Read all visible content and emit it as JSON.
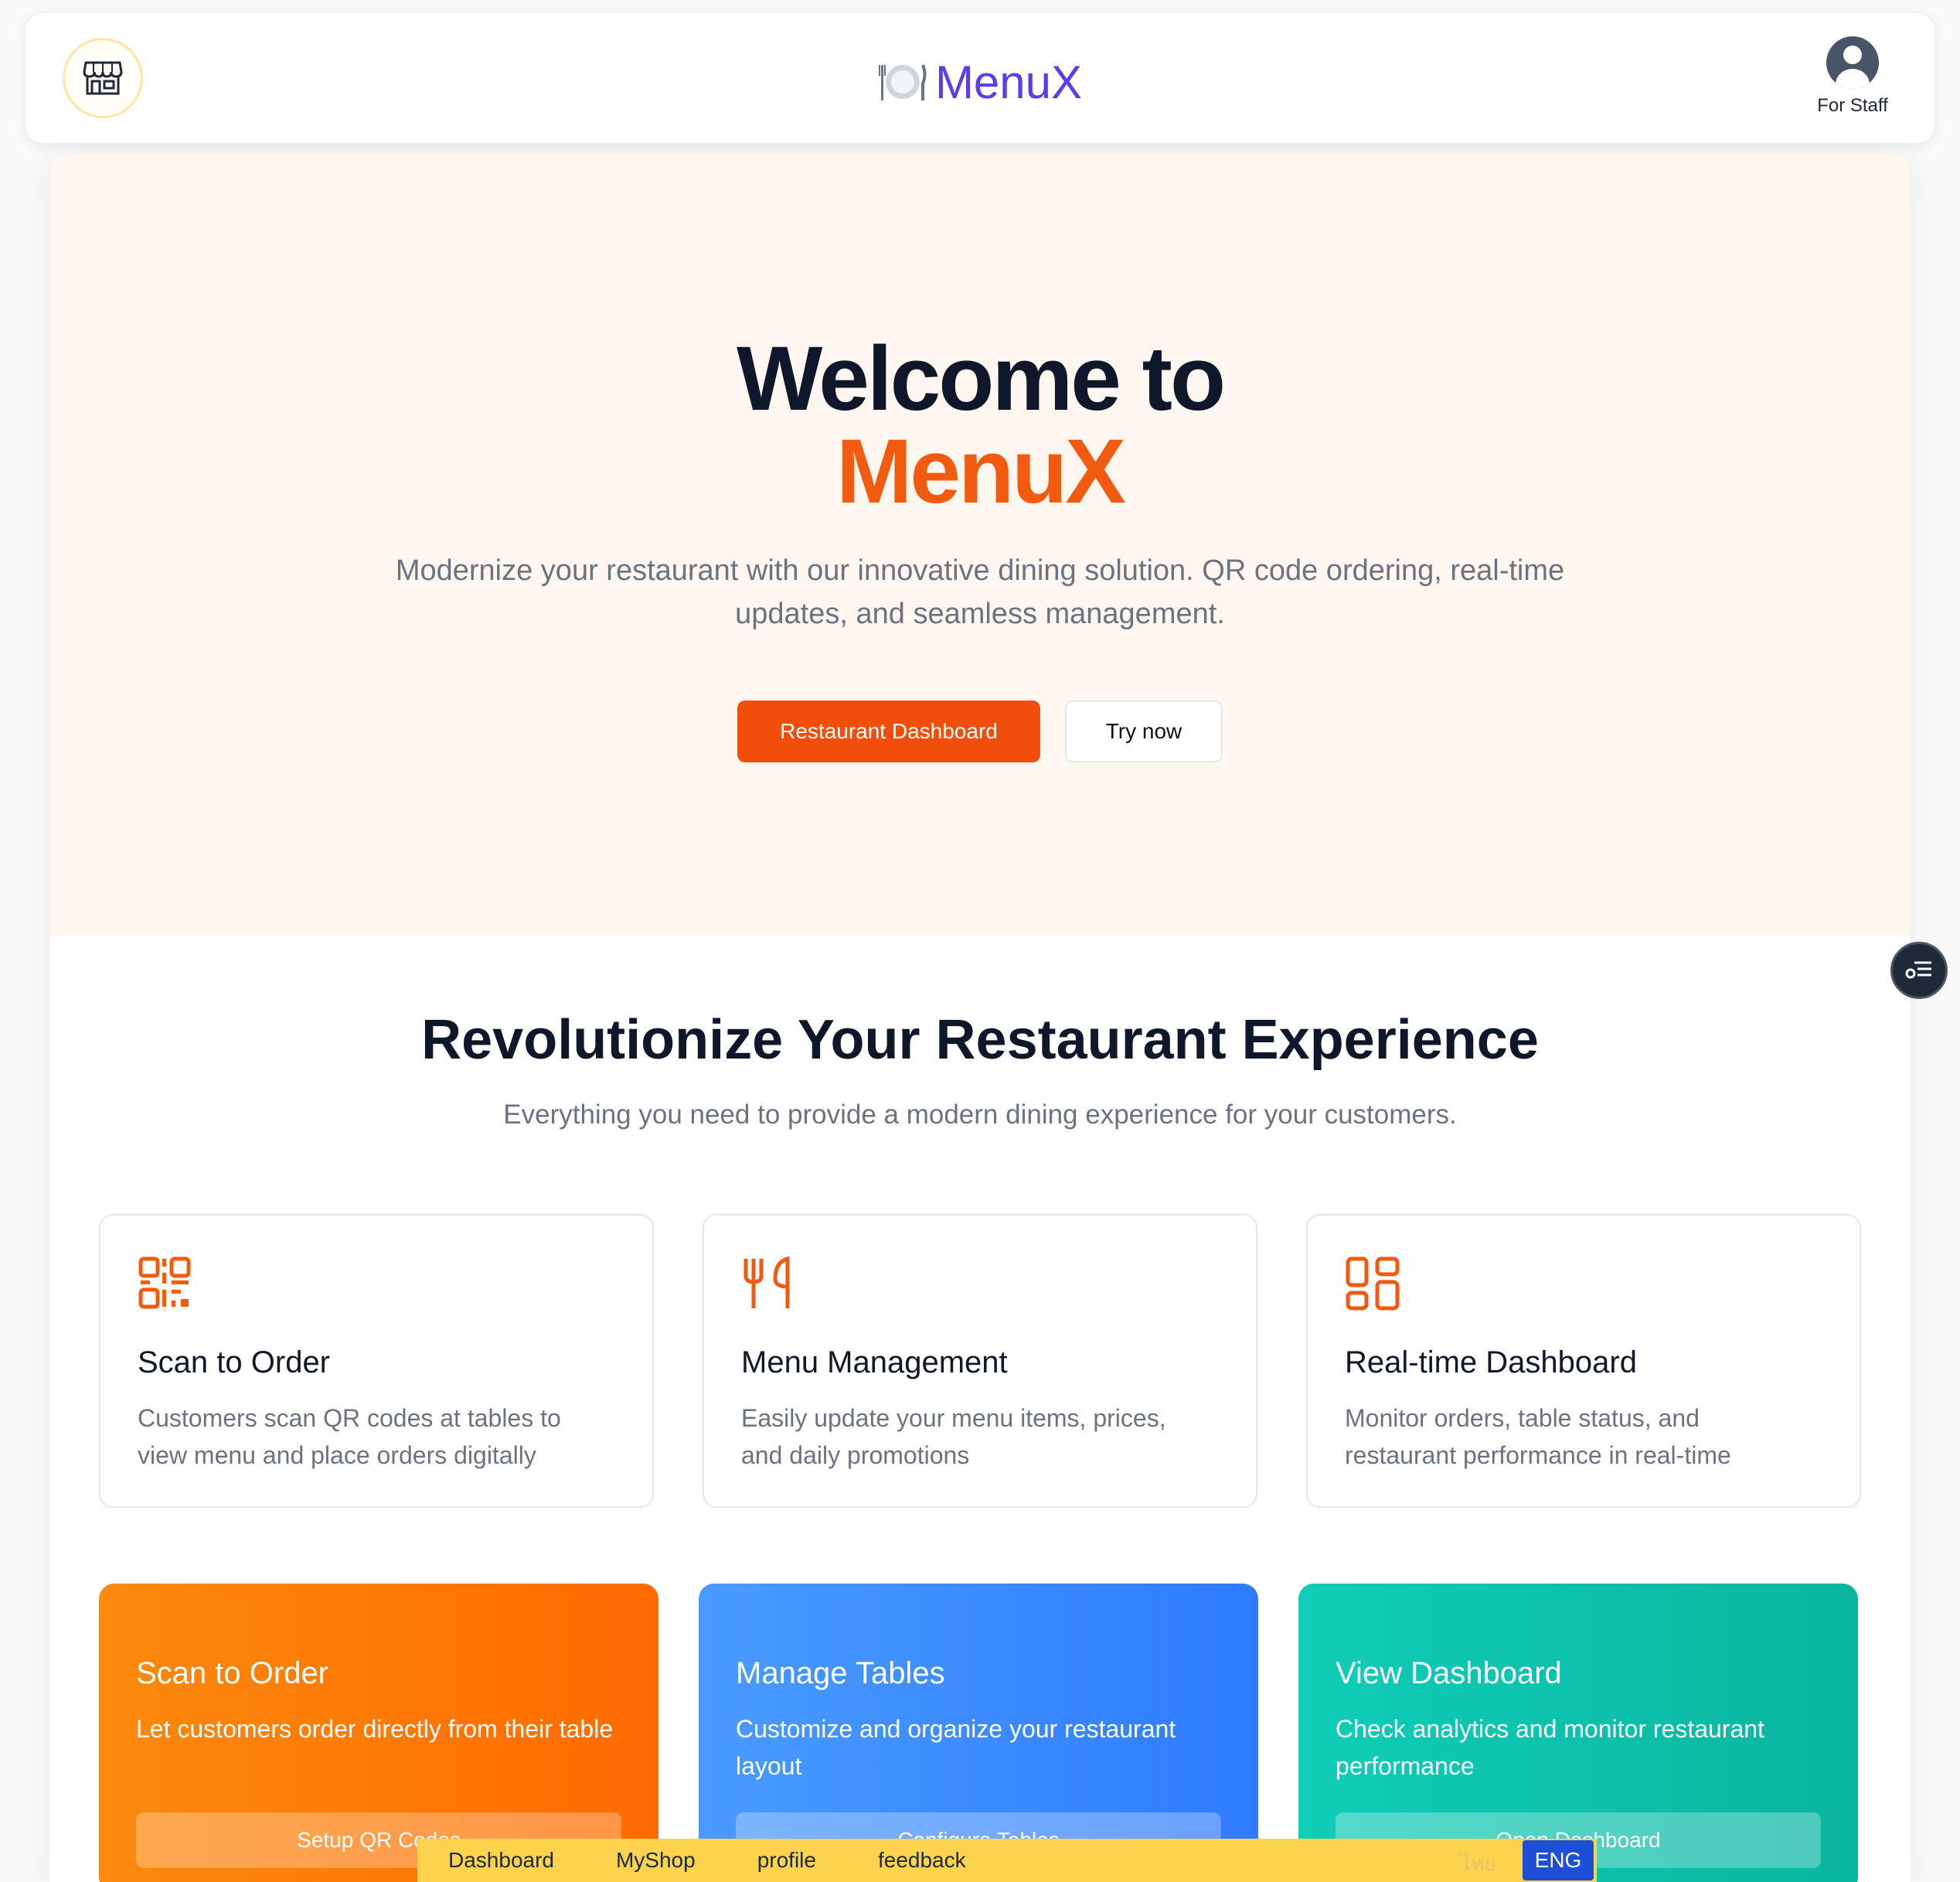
{
  "header": {
    "brand_name": "MenuX",
    "brand_emoji": "🍽️",
    "staff_label": "For Staff"
  },
  "hero": {
    "title_line1": "Welcome to",
    "title_line2": "MenuX",
    "subtitle": "Modernize your restaurant with our innovative dining solution. QR code ordering, real-time updates, and seamless management.",
    "primary_button": "Restaurant Dashboard",
    "secondary_button": "Try now"
  },
  "features_section": {
    "title": "Revolutionize Your Restaurant Experience",
    "subtitle": "Everything you need to provide a modern dining experience for your customers.",
    "items": [
      {
        "icon": "qr-code-icon",
        "title": "Scan to Order",
        "desc": "Customers scan QR codes at tables to view menu and place orders digitally"
      },
      {
        "icon": "utensils-icon",
        "title": "Menu Management",
        "desc": "Easily update your menu items, prices, and daily promotions"
      },
      {
        "icon": "dashboard-icon",
        "title": "Real-time Dashboard",
        "desc": "Monitor orders, table status, and restaurant performance in real-time"
      }
    ]
  },
  "actions": [
    {
      "title": "Scan to Order",
      "desc": "Let customers order directly from their table",
      "button": "Setup QR Codes"
    },
    {
      "title": "Manage Tables",
      "desc": "Customize and organize your restaurant layout",
      "button": "Configure Tables"
    },
    {
      "title": "View Dashboard",
      "desc": "Check analytics and monitor restaurant performance",
      "button": "Open Dashboard"
    }
  ],
  "bottom_bar": {
    "links": [
      "Dashboard",
      "MyShop",
      "profile",
      "feedback"
    ],
    "lang_th": "ไทย",
    "lang_en": "ENG"
  },
  "colors": {
    "brand": "#5b3df0",
    "accent": "#f25a10",
    "hero_bg": "#fef7ef"
  }
}
